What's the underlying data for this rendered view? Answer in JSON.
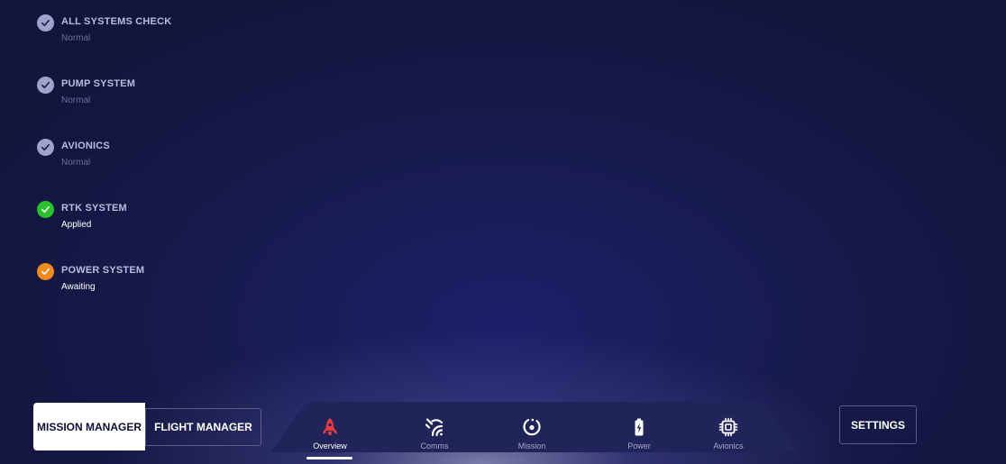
{
  "status_items": [
    {
      "title": "ALL SYSTEMS CHECK",
      "subtitle": "Normal",
      "state": "normal",
      "icon": "check-icon"
    },
    {
      "title": "PUMP SYSTEM",
      "subtitle": "Normal",
      "state": "normal",
      "icon": "check-icon"
    },
    {
      "title": "AVIONICS",
      "subtitle": "Normal",
      "state": "normal",
      "icon": "check-icon"
    },
    {
      "title": "RTK SYSTEM",
      "subtitle": "Applied",
      "state": "applied",
      "icon": "check-icon"
    },
    {
      "title": "POWER SYSTEM",
      "subtitle": "Awaiting",
      "state": "awaiting",
      "icon": "check-icon"
    }
  ],
  "colors": {
    "normal": "#9fa2cc",
    "applied": "#27c22a",
    "awaiting": "#f08a1a",
    "nav_active": "#ef3b3b",
    "nav_icon": "#ffffff",
    "nav_bar": "#202458"
  },
  "buttons": {
    "mission_manager": "MISSION MANAGER",
    "flight_manager": "FLIGHT MANAGER",
    "settings": "SETTINGS"
  },
  "nav": {
    "active": "Overview",
    "items": [
      {
        "label": "Overview",
        "icon": "rocket-icon"
      },
      {
        "label": "Comms",
        "icon": "signal-icon"
      },
      {
        "label": "Mission",
        "icon": "mission-target-icon"
      },
      {
        "label": "Power",
        "icon": "battery-charging-icon"
      },
      {
        "label": "Avionics",
        "icon": "chip-icon"
      }
    ]
  }
}
